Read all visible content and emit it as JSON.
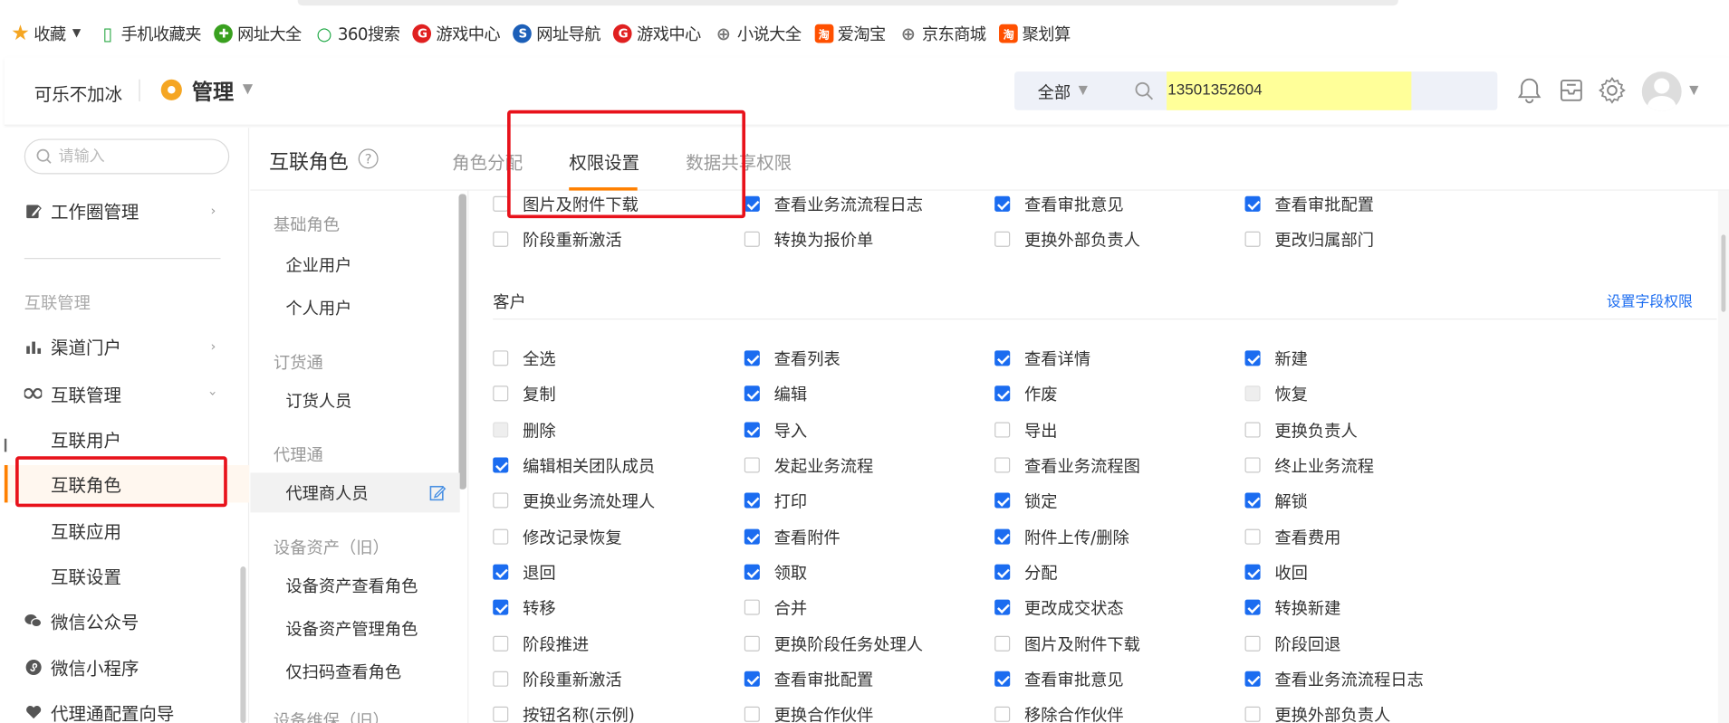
{
  "bookmarks": {
    "favorites": "收藏",
    "items": [
      {
        "label": "手机收藏夹",
        "icon": "phone-icon",
        "color": "#2aa845"
      },
      {
        "label": "网址大全",
        "icon": "hao123-icon",
        "color": "#39a01f"
      },
      {
        "label": "360搜索",
        "icon": "360-search-icon",
        "color": "#19a640"
      },
      {
        "label": "游戏中心",
        "icon": "game-center-icon",
        "color": "#e02020"
      },
      {
        "label": "网址导航",
        "icon": "sogou-nav-icon",
        "color": "#1c5fb8"
      },
      {
        "label": "游戏中心",
        "icon": "game-center-icon",
        "color": "#e02020"
      },
      {
        "label": "小说大全",
        "icon": "globe-icon",
        "color": "#777777"
      },
      {
        "label": "爱淘宝",
        "icon": "taobao-icon",
        "color": "#ff5000"
      },
      {
        "label": "京东商城",
        "icon": "globe-icon",
        "color": "#777777"
      },
      {
        "label": "聚划算",
        "icon": "taobao-icon",
        "color": "#ff5000"
      }
    ]
  },
  "header": {
    "user": "可乐不加冰",
    "title": "管理",
    "search_scope": "全部",
    "search_value": "13501352604"
  },
  "sidebar": {
    "search_placeholder": "请输入",
    "work_circle": "工作圈管理",
    "group": "互联管理",
    "channel_portal": "渠道门户",
    "interconnect_mgmt": "互联管理",
    "sub_items": [
      "互联用户",
      "互联角色",
      "互联应用",
      "互联设置"
    ],
    "active_sub": "互联角色",
    "wechat_official": "微信公众号",
    "wechat_mini": "微信小程序",
    "agent_wizard": "代理通配置向导"
  },
  "content": {
    "title": "互联角色",
    "tabs": [
      "角色分配",
      "权限设置",
      "数据共享权限"
    ],
    "active_tab": "权限设置"
  },
  "roles": {
    "groups": [
      {
        "name": "基础角色",
        "items": [
          "企业用户",
          "个人用户"
        ]
      },
      {
        "name": "订货通",
        "items": [
          "订货人员"
        ]
      },
      {
        "name": "代理通",
        "items": [
          "代理商人员"
        ]
      },
      {
        "name": "设备资产（旧）",
        "items": [
          "设备资产查看角色",
          "设备资产管理角色",
          "仅扫码查看角色"
        ]
      },
      {
        "name": "设备维保（旧）",
        "items": []
      }
    ],
    "active": "代理商人员"
  },
  "permissions": {
    "top_rows": [
      [
        {
          "label": "图片及附件下载",
          "state": "off"
        },
        {
          "label": "查看业务流流程日志",
          "state": "on"
        },
        {
          "label": "查看审批意见",
          "state": "on"
        },
        {
          "label": "查看审批配置",
          "state": "on"
        }
      ],
      [
        {
          "label": "阶段重新激活",
          "state": "off"
        },
        {
          "label": "转换为报价单",
          "state": "off"
        },
        {
          "label": "更换外部负责人",
          "state": "off"
        },
        {
          "label": "更改归属部门",
          "state": "off"
        }
      ]
    ],
    "section": {
      "title": "客户",
      "field_link": "设置字段权限",
      "rows": [
        [
          {
            "label": "全选",
            "state": "off"
          },
          {
            "label": "查看列表",
            "state": "on"
          },
          {
            "label": "查看详情",
            "state": "on"
          },
          {
            "label": "新建",
            "state": "on"
          }
        ],
        [
          {
            "label": "复制",
            "state": "off"
          },
          {
            "label": "编辑",
            "state": "on"
          },
          {
            "label": "作废",
            "state": "on"
          },
          {
            "label": "恢复",
            "state": "disabled"
          }
        ],
        [
          {
            "label": "删除",
            "state": "disabled"
          },
          {
            "label": "导入",
            "state": "on"
          },
          {
            "label": "导出",
            "state": "off"
          },
          {
            "label": "更换负责人",
            "state": "off"
          }
        ],
        [
          {
            "label": "编辑相关团队成员",
            "state": "on"
          },
          {
            "label": "发起业务流程",
            "state": "off"
          },
          {
            "label": "查看业务流程图",
            "state": "off"
          },
          {
            "label": "终止业务流程",
            "state": "off"
          }
        ],
        [
          {
            "label": "更换业务流处理人",
            "state": "off"
          },
          {
            "label": "打印",
            "state": "on"
          },
          {
            "label": "锁定",
            "state": "on"
          },
          {
            "label": "解锁",
            "state": "on"
          }
        ],
        [
          {
            "label": "修改记录恢复",
            "state": "off"
          },
          {
            "label": "查看附件",
            "state": "on"
          },
          {
            "label": "附件上传/删除",
            "state": "on"
          },
          {
            "label": "查看费用",
            "state": "off"
          }
        ],
        [
          {
            "label": "退回",
            "state": "on"
          },
          {
            "label": "领取",
            "state": "on"
          },
          {
            "label": "分配",
            "state": "on"
          },
          {
            "label": "收回",
            "state": "on"
          }
        ],
        [
          {
            "label": "转移",
            "state": "on"
          },
          {
            "label": "合并",
            "state": "off"
          },
          {
            "label": "更改成交状态",
            "state": "on"
          },
          {
            "label": "转换新建",
            "state": "on"
          }
        ],
        [
          {
            "label": "阶段推进",
            "state": "off"
          },
          {
            "label": "更换阶段任务处理人",
            "state": "off"
          },
          {
            "label": "图片及附件下载",
            "state": "off"
          },
          {
            "label": "阶段回退",
            "state": "off"
          }
        ],
        [
          {
            "label": "阶段重新激活",
            "state": "off"
          },
          {
            "label": "查看审批配置",
            "state": "on"
          },
          {
            "label": "查看审批意见",
            "state": "on"
          },
          {
            "label": "查看业务流流程日志",
            "state": "on"
          }
        ],
        [
          {
            "label": "按钮名称(示例)",
            "state": "off"
          },
          {
            "label": "更换合作伙伴",
            "state": "off"
          },
          {
            "label": "移除合作伙伴",
            "state": "off"
          },
          {
            "label": "更换外部负责人",
            "state": "off"
          }
        ]
      ]
    }
  },
  "colors": {
    "accent": "#ff8000",
    "checkbox": "#1b6cf0",
    "highlight_box": "#e8121b",
    "search_highlight": "#ffff99"
  }
}
